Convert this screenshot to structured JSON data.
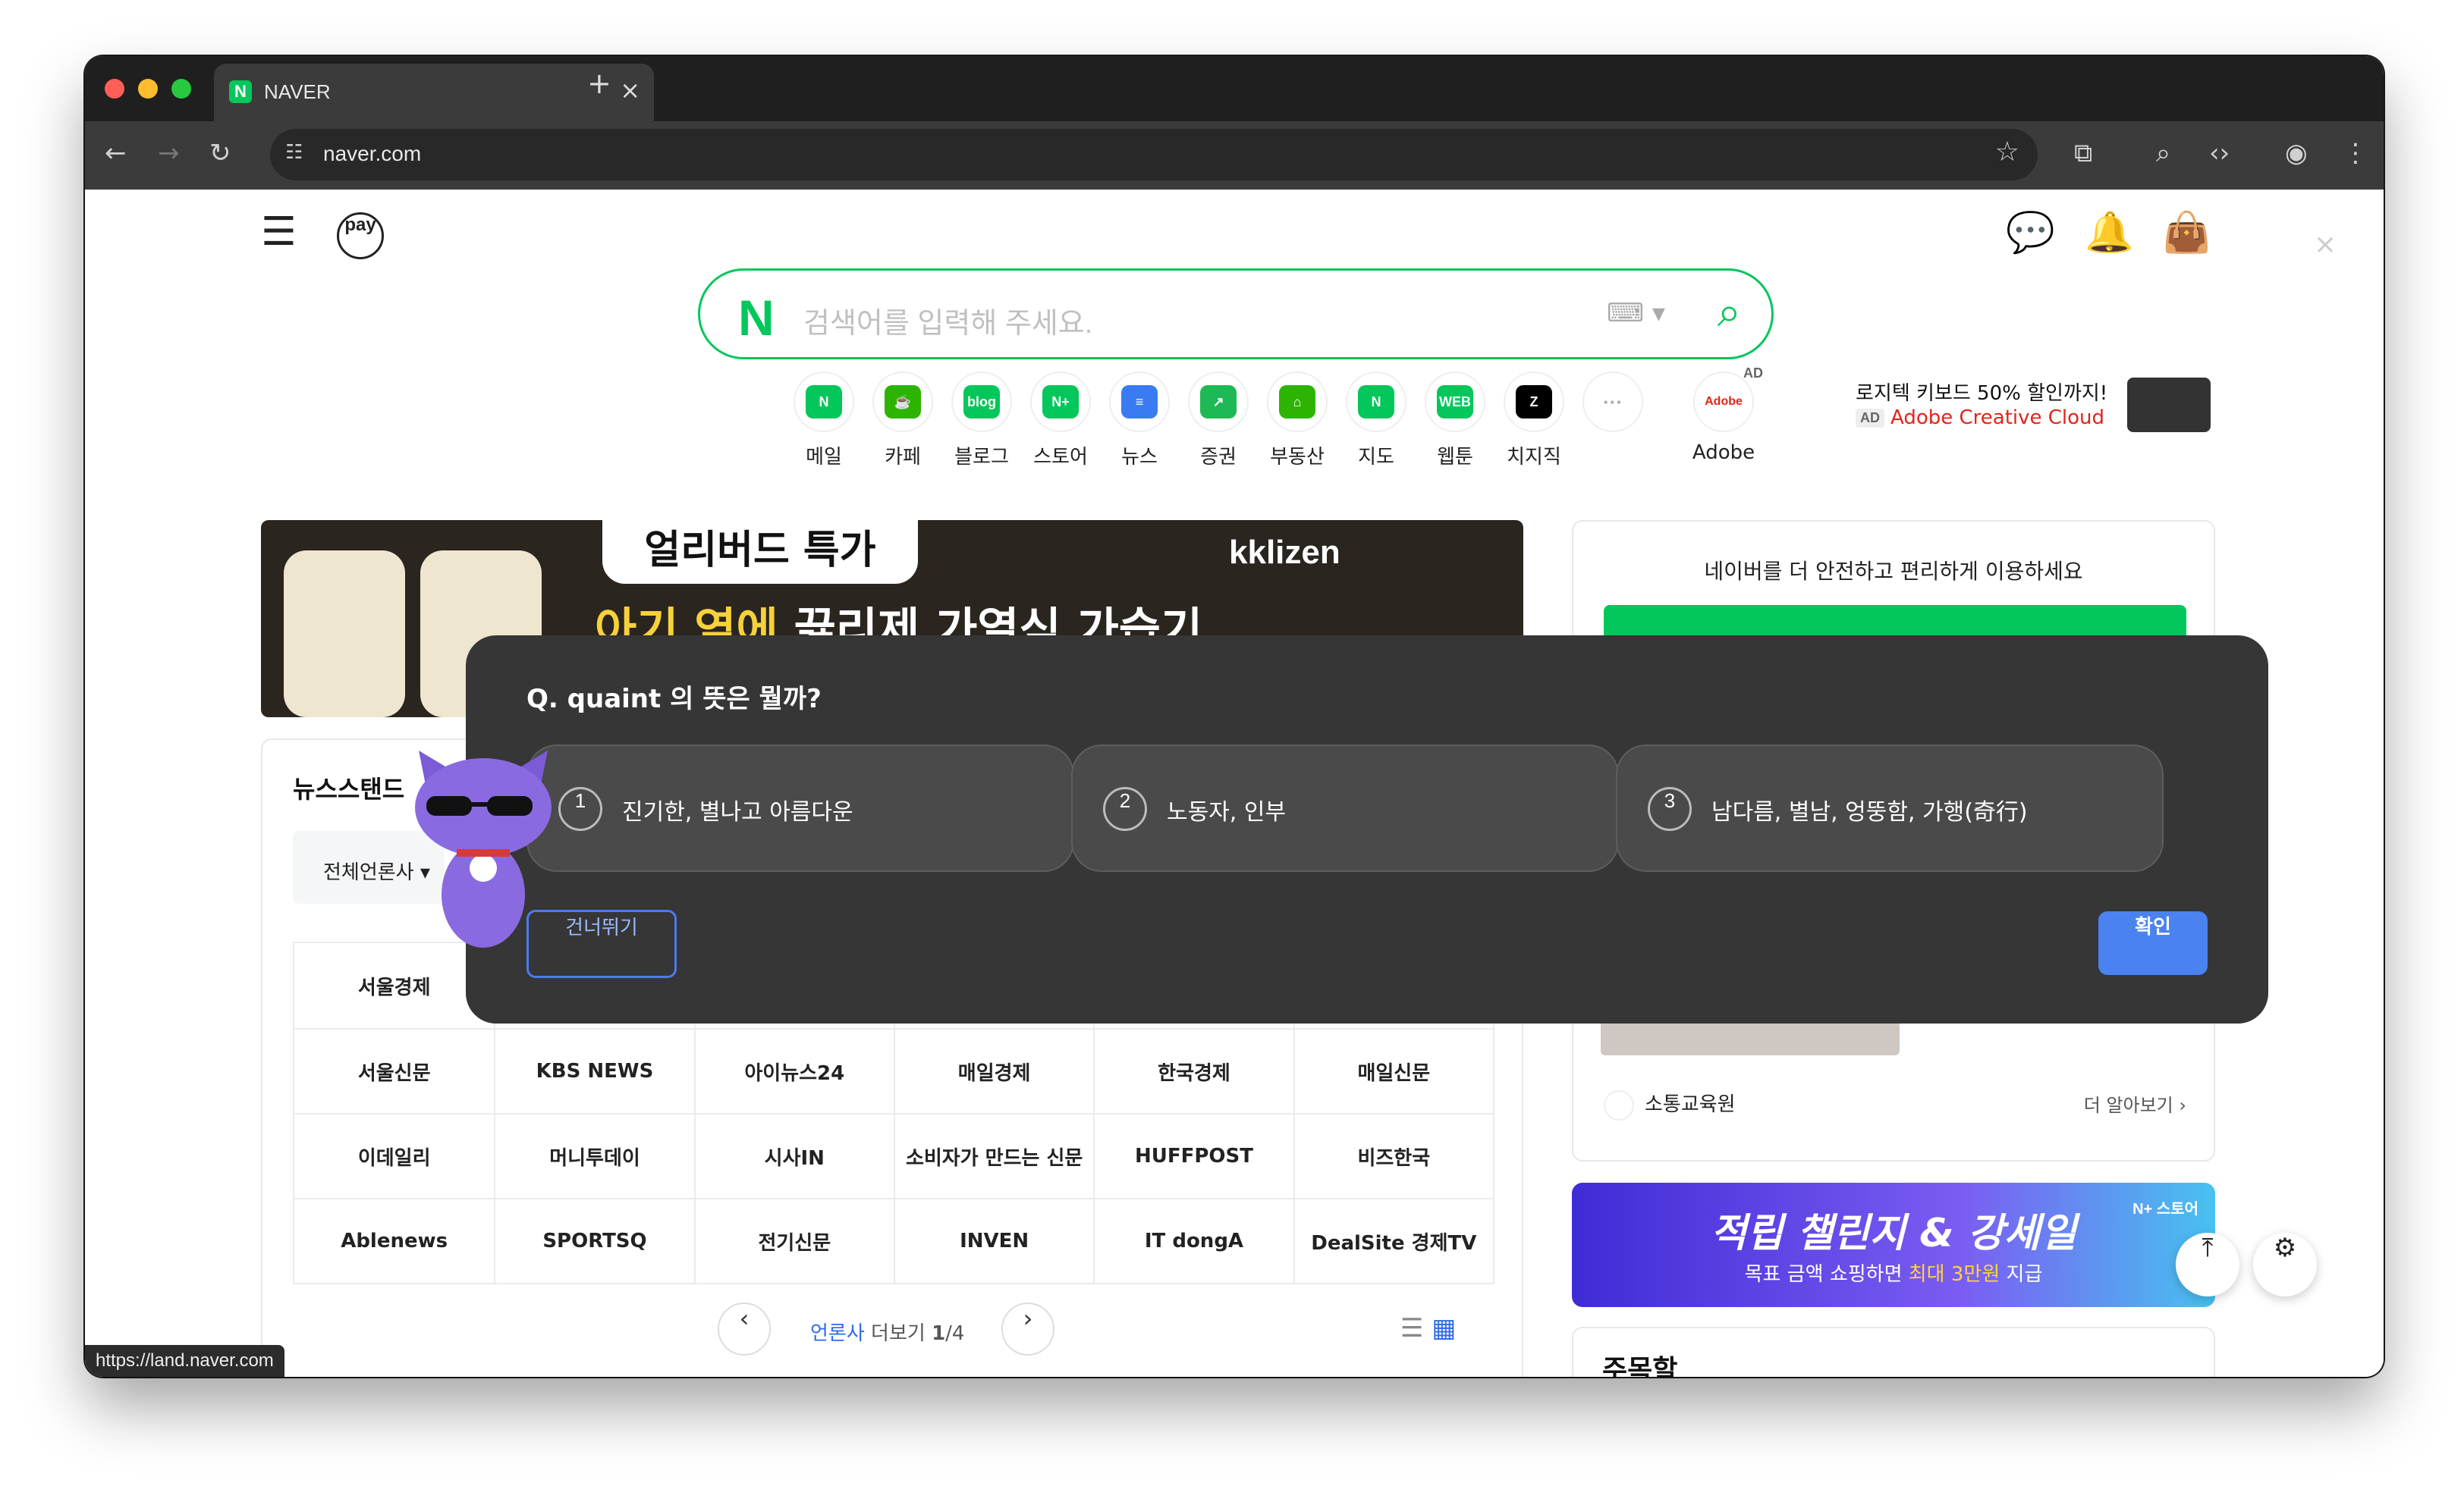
{
  "browser": {
    "tab_title": "NAVER",
    "tab_favicon": "N",
    "close_tab": "×",
    "new_tab": "+",
    "url": "naver.com",
    "status_url": "https://land.naver.com"
  },
  "header": {
    "pay_label": "pay",
    "close_ad": "×"
  },
  "search": {
    "logo": "N",
    "placeholder": "검색어를 입력해 주세요."
  },
  "services": [
    {
      "label": "메일",
      "icon": "mail-icon",
      "color": "#03c75a",
      "glyph": "N"
    },
    {
      "label": "카페",
      "icon": "cafe-icon",
      "color": "#2db400",
      "glyph": "☕"
    },
    {
      "label": "블로그",
      "icon": "blog-icon",
      "color": "#03c75a",
      "glyph": "blog"
    },
    {
      "label": "스토어",
      "icon": "store-icon",
      "color": "#03c75a",
      "glyph": "N+"
    },
    {
      "label": "뉴스",
      "icon": "news-icon",
      "color": "#3a7bf2",
      "glyph": "≡"
    },
    {
      "label": "증권",
      "icon": "stock-icon",
      "color": "#1db954",
      "glyph": "↗"
    },
    {
      "label": "부동산",
      "icon": "realestate-icon",
      "color": "#2db400",
      "glyph": "⌂"
    },
    {
      "label": "지도",
      "icon": "map-icon",
      "color": "#03c75a",
      "glyph": "N"
    },
    {
      "label": "웹툰",
      "icon": "webtoon-icon",
      "color": "#03c75a",
      "glyph": "WEB"
    },
    {
      "label": "치지직",
      "icon": "chzzk-icon",
      "color": "#000000",
      "glyph": "Z"
    }
  ],
  "more_glyph": "···",
  "adobe_service": {
    "label": "Adobe",
    "badge": "AD",
    "glyph": "Adobe"
  },
  "ad": {
    "line1": "로지텍 키보드 50% 할인까지!",
    "badge": "AD",
    "line2": "Adobe Creative Cloud"
  },
  "top_banner": {
    "tag": "얼리버드 특가",
    "headline_highlight": "아기 옆에",
    "headline_rest": " 끓리제 가열식 가습기",
    "brand": "kklizen"
  },
  "right_box": {
    "title": "네이버를 더 안전하고 편리하게 이용하세요",
    "source": "소통교육원",
    "more": "더 알아보기 ›"
  },
  "store_banner": {
    "headline": "적립 챌린지 & 강세일",
    "sub_prefix": "목표 금액 쇼핑하면 ",
    "sub_highlight": "최대 3만원",
    "sub_suffix": " 지급",
    "brand": "N+ 스토어"
  },
  "lower_right": {
    "title": "주목할"
  },
  "newsstand": {
    "title": "뉴스스탠드",
    "filter": "전체언론사 ▾",
    "rows": [
      [
        "서울경제",
        "",
        "",
        "",
        "",
        ""
      ],
      [
        "서울신문",
        "KBS NEWS",
        "아이뉴스24",
        "매일경제",
        "한국경제",
        "매일신문"
      ],
      [
        "이데일리",
        "머니투데이",
        "시사IN",
        "소비자가 만드는 신문",
        "HUFFPOST",
        "비즈한국"
      ],
      [
        "Ablenews",
        "SPORTSQ",
        "전기신문",
        "INVEN",
        "IT dongA",
        "DealSite 경제TV"
      ]
    ],
    "pager_active": "언론사",
    "pager_text": " 더보기 ",
    "page_current": "1",
    "page_total": "/4",
    "prev": "‹",
    "next": "›"
  },
  "quiz": {
    "question": "Q. quaint 의 뜻은 뭘까?",
    "options": [
      {
        "num": "1",
        "text": "진기한, 별나고 아름다운"
      },
      {
        "num": "2",
        "text": "노동자, 인부"
      },
      {
        "num": "3",
        "text": "남다름, 별남, 엉뚱함, 가행(奇行)"
      }
    ],
    "skip": "건너뛰기",
    "confirm": "확인"
  }
}
